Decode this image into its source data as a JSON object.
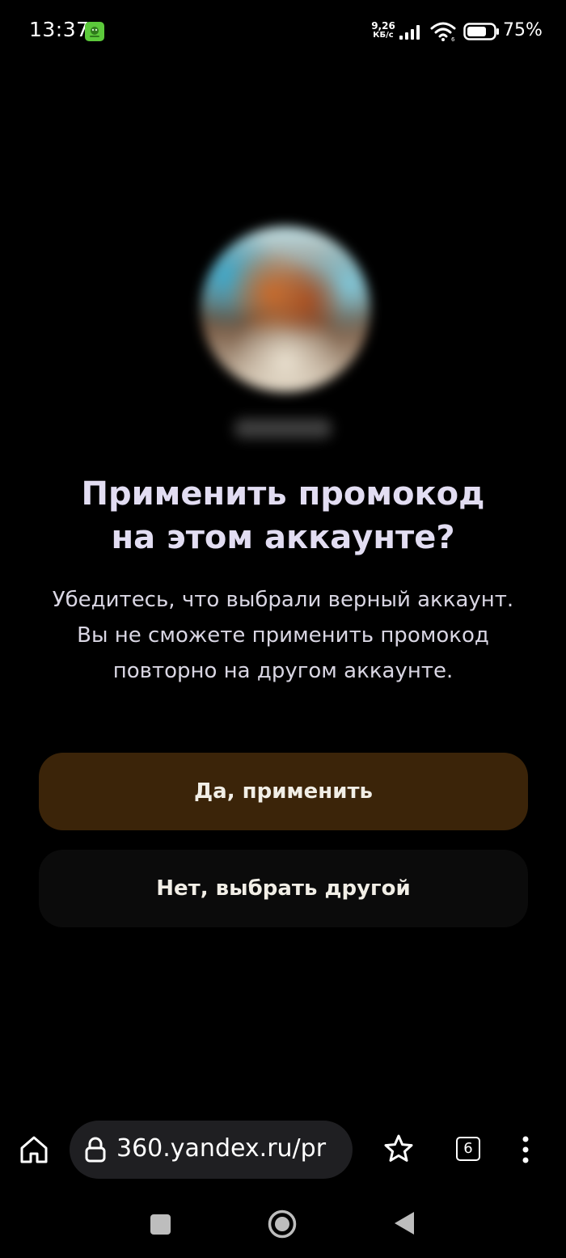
{
  "status_bar": {
    "time": "13:37",
    "app_icon": "dr-web-icon",
    "net_speed_value": "9,26",
    "net_speed_unit": "КБ/с",
    "battery_percent": "75%",
    "battery_level": 0.75
  },
  "dialog": {
    "title_line1": "Применить промокод",
    "title_line2": "на этом аккаунте?",
    "desc_line1": "Убедитесь, что выбрали верный аккаунт.",
    "desc_line2": "Вы не сможете применить промокод",
    "desc_line3": "повторно на другом аккаунте.",
    "confirm_label": "Да, применить",
    "cancel_label": "Нет, выбрать другой"
  },
  "browser": {
    "url": "360.yandex.ru/pr",
    "tab_count": "6"
  },
  "colors": {
    "background": "#000000",
    "title": "#e2ddf2",
    "primary_button": "#3b2409",
    "secondary_button": "#0b0b0b",
    "url_pill": "#1f1f22"
  },
  "icons": {
    "home": "home-icon",
    "lock": "lock-icon",
    "star": "star-icon",
    "tabs": "tabs-icon",
    "menu": "more-vertical-icon",
    "recents": "recents-icon",
    "home_nav": "home-nav-icon",
    "back": "back-icon"
  }
}
